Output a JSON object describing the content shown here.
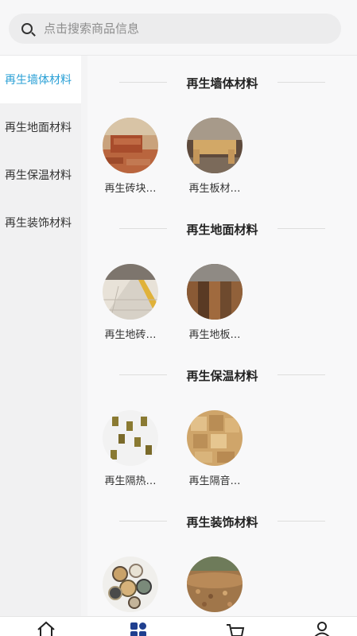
{
  "search": {
    "placeholder": "点击搜索商品信息",
    "icon": "search-icon"
  },
  "sidebar": {
    "items": [
      {
        "label": "再生墙体材料",
        "active": true
      },
      {
        "label": "再生地面材料",
        "active": false
      },
      {
        "label": "再生保温材料",
        "active": false
      },
      {
        "label": "再生装饰材料",
        "active": false
      }
    ]
  },
  "sections": [
    {
      "title": "再生墙体材料",
      "items": [
        {
          "name": "再生砖块…"
        },
        {
          "name": "再生板材…"
        }
      ]
    },
    {
      "title": "再生地面材料",
      "items": [
        {
          "name": "再生地砖…"
        },
        {
          "name": "再生地板…"
        }
      ]
    },
    {
      "title": "再生保温材料",
      "items": [
        {
          "name": "再生隔热…"
        },
        {
          "name": "再生隔音…"
        }
      ]
    },
    {
      "title": "再生装饰材料",
      "items": [
        {
          "name": ""
        },
        {
          "name": ""
        }
      ]
    }
  ],
  "tabbar": {
    "tabs": [
      {
        "icon": "home-icon"
      },
      {
        "icon": "category-icon",
        "active": true
      },
      {
        "icon": "cart-icon"
      },
      {
        "icon": "user-icon"
      }
    ],
    "active_color": "#1f3f8f"
  },
  "colors": {
    "accent": "#2aa0d6"
  }
}
